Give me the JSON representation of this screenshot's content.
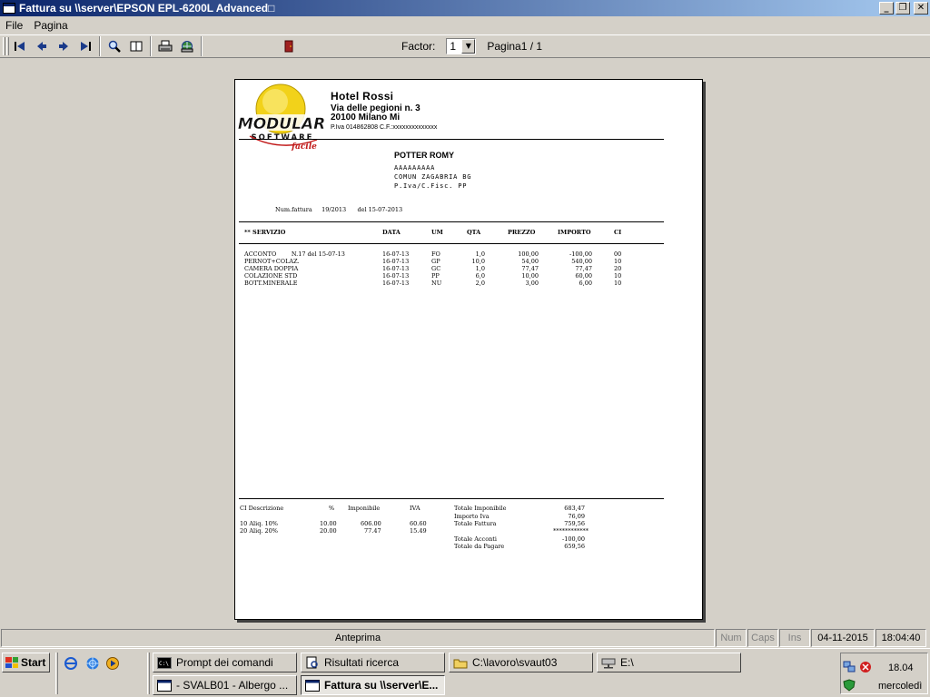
{
  "window": {
    "title": "Fattura su \\\\server\\EPSON EPL-6200L Advanced□",
    "minimize": "_",
    "restore": "❐",
    "close": "✕"
  },
  "menu": {
    "file": "File",
    "pagina": "Pagina"
  },
  "toolbar": {
    "factor_label": "Factor:",
    "factor_value": "1",
    "page_label": "Pagina1 / 1"
  },
  "invoice": {
    "hotel": {
      "name": "Hotel Rossi",
      "address": "Via delle pegioni n. 3",
      "city": "20100 Milano Mi",
      "piva": "P.Iva 014862808  C.F.:xxxxxxxxxxxxxx"
    },
    "logo": {
      "main": "MODULAR",
      "sub": "SOFTWARE",
      "script": "facile"
    },
    "customer": {
      "name": "POTTER ROMY",
      "line1": "AAAAAAAAA",
      "line2": "COMUN ZAGABRIA BG",
      "line3": "P.Iva/C.Fisc. PP"
    },
    "number_line": "Num.fattura     19/2013      del 15-07-2013",
    "columns": {
      "servizio": "** SERVIZIO",
      "data": "DATA",
      "um": "UM",
      "qta": "QTA",
      "prezzo": "PREZZO",
      "importo": "IMPORTO",
      "ci": "CI"
    },
    "rows": [
      {
        "desc": "ACCONTO        N.17 del 15-07-13",
        "data": "16-07-13",
        "um": "FO",
        "qta": "1,0",
        "prezzo": "100,00",
        "importo": "-100,00",
        "ci": "00"
      },
      {
        "desc": "PERNOT+COLAZ.",
        "data": "16-07-13",
        "um": "GP",
        "qta": "10,0",
        "prezzo": "54,00",
        "importo": "540,00",
        "ci": "10"
      },
      {
        "desc": "CAMERA DOPPIA",
        "data": "16-07-13",
        "um": "GC",
        "qta": "1,0",
        "prezzo": "77,47",
        "importo": "77,47",
        "ci": "20"
      },
      {
        "desc": "COLAZIONE STD",
        "data": "16-07-13",
        "um": "PP",
        "qta": "6,0",
        "prezzo": "10,00",
        "importo": "60,00",
        "ci": "10"
      },
      {
        "desc": "BOTT.MINERALE",
        "data": "16-07-13",
        "um": "NU",
        "qta": "2,0",
        "prezzo": "3,00",
        "importo": "6,00",
        "ci": "10"
      }
    ],
    "vat_header": {
      "ci_desc": "CI Descrizione",
      "pct": "%",
      "imponibile": "Imponibile",
      "iva": "IVA"
    },
    "vat_rows": [
      {
        "desc": "10 Aliq. 10%",
        "pct": "10.00",
        "imponibile": "606.00",
        "iva": "60.60"
      },
      {
        "desc": "20 Aliq. 20%",
        "pct": "20.00",
        "imponibile": "77.47",
        "iva": "15.49"
      }
    ],
    "totals": [
      {
        "label": "Totale Imponibile",
        "value": "683,47"
      },
      {
        "label": "Importo Iva",
        "value": "76,09"
      },
      {
        "label": "Totale Fattura",
        "value": "759,56"
      },
      {
        "label": "",
        "value": "************"
      },
      {
        "label": "Totale Acconti",
        "value": "-100,00"
      },
      {
        "label": "Totale da Pagare",
        "value": "659,56"
      }
    ]
  },
  "status": {
    "main": "Anteprima",
    "num": "Num",
    "caps": "Caps",
    "ins": "Ins",
    "date": "04-11-2015",
    "time": "18:04:40"
  },
  "taskbar": {
    "start": "Start",
    "tasks": [
      "Prompt dei comandi",
      "Risultati ricerca",
      "C:\\lavoro\\svaut03",
      "E:\\",
      "- SVALB01 - Albergo          ...",
      "Fattura su \\\\server\\E..."
    ],
    "clock": "18.04",
    "day": "mercoledì"
  }
}
